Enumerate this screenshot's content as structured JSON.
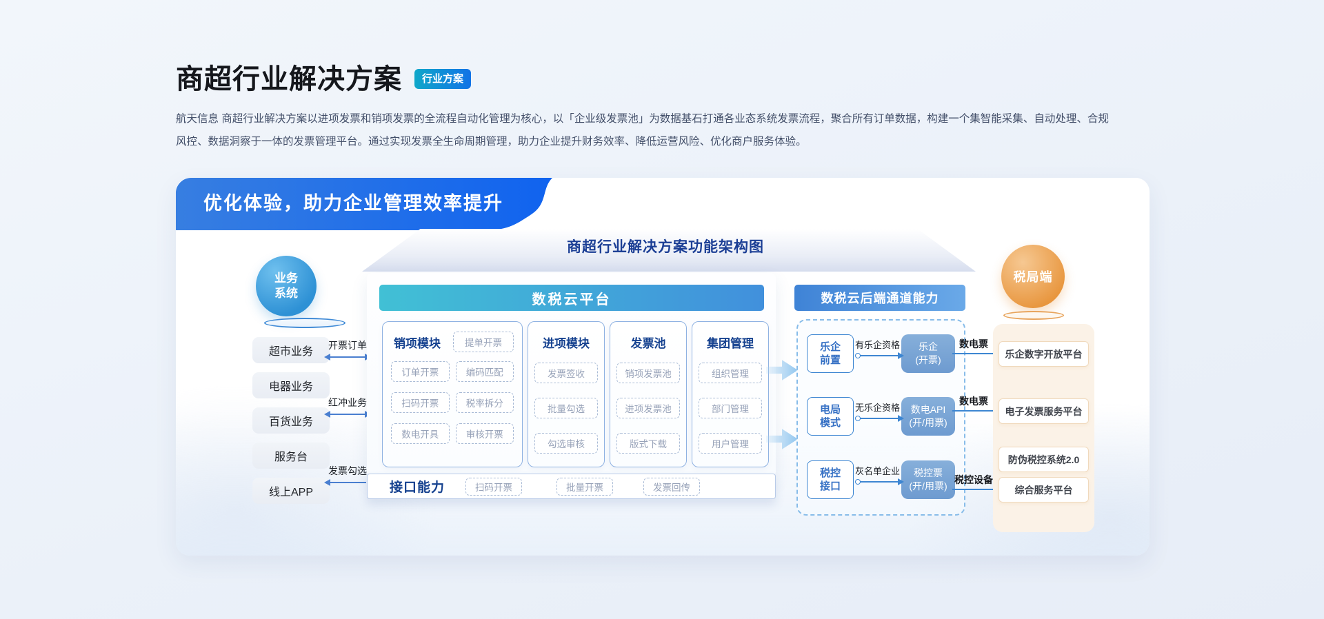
{
  "colors": {
    "badge_gradient": [
      "#0FA7C9",
      "#1273E6"
    ],
    "ribbon_gradient": [
      "#377EE1",
      "#1063EF"
    ],
    "platform_header_gradient": [
      "#41C0D5",
      "#4190DC"
    ],
    "channel_header_gradient": [
      "#3F83D6",
      "#6AA9E8"
    ],
    "deep_blue_text": "#15418F",
    "arrow_blue": "#4A7FD0",
    "business_circle_blue": "#2E91D5",
    "tax_circle_orange": "#E8963E"
  },
  "header": {
    "title": "商超行业解决方案",
    "badge": "行业方案",
    "description": [
      "航天信息 商超行业解决方案以进项发票和销项发票的全流程自动化管理为核心，以「企业级发票池」为数据基石打通各业态系统发票流程，聚合所有订单数据，构建一个集智能采集、自动处理、合规",
      "风控、数据洞察于一体的发票管理平台。通过实现发票全生命周期管理，助力企业提升财务效率、降低运营风险、优化商户服务体验。"
    ]
  },
  "banner": {
    "ribbon": "优化体验，助力企业管理效率提升",
    "diagram_title": "商超行业解决方案功能架构图"
  },
  "business": {
    "circle": [
      "业务",
      "系统"
    ],
    "items": [
      "超市业务",
      "电器业务",
      "百货业务",
      "服务台",
      "线上APP"
    ],
    "flows": [
      {
        "label": "开票订单",
        "direction": "both"
      },
      {
        "label": "红冲业务",
        "direction": "both"
      },
      {
        "label": "发票勾选",
        "direction": "left"
      }
    ]
  },
  "platform": {
    "header": "数税云平台",
    "module1": {
      "name": "销项模块",
      "featured": "提单开票",
      "items": [
        "订单开票",
        "编码匹配",
        "扫码开票",
        "税率拆分",
        "数电开具",
        "审核开票"
      ]
    },
    "module2": {
      "name": "进项模块",
      "items": [
        "发票签收",
        "批量勾选",
        "勾选审核"
      ]
    },
    "module3": {
      "name": "发票池",
      "items": [
        "销项发票池",
        "进项发票池",
        "版式下载"
      ]
    },
    "module4": {
      "name": "集团管理",
      "items": [
        "组织管理",
        "部门管理",
        "用户管理"
      ]
    },
    "interface": {
      "title": "接口能力",
      "items": [
        "扫码开票",
        "批量开票",
        "发票回传"
      ]
    }
  },
  "channel": {
    "header": "数税云后端通道能力",
    "rows": [
      {
        "source": [
          "乐企",
          "前置"
        ],
        "condition": "有乐企资格",
        "target": [
          "乐企",
          "(开票)"
        ],
        "output": "数电票"
      },
      {
        "source": [
          "电局",
          "模式"
        ],
        "condition": "无乐企资格",
        "target": [
          "数电API",
          "(开/用票)"
        ],
        "output": "数电票"
      },
      {
        "source": [
          "税控",
          "接口"
        ],
        "condition": "灰名单企业",
        "target": [
          "税控票",
          "(开/用票)"
        ],
        "output": "税控设备"
      }
    ]
  },
  "tax_bureau": {
    "circle": "税局端",
    "items": [
      "乐企数字开放平台",
      "电子发票服务平台",
      "防伪税控系统2.0",
      "综合服务平台"
    ]
  }
}
